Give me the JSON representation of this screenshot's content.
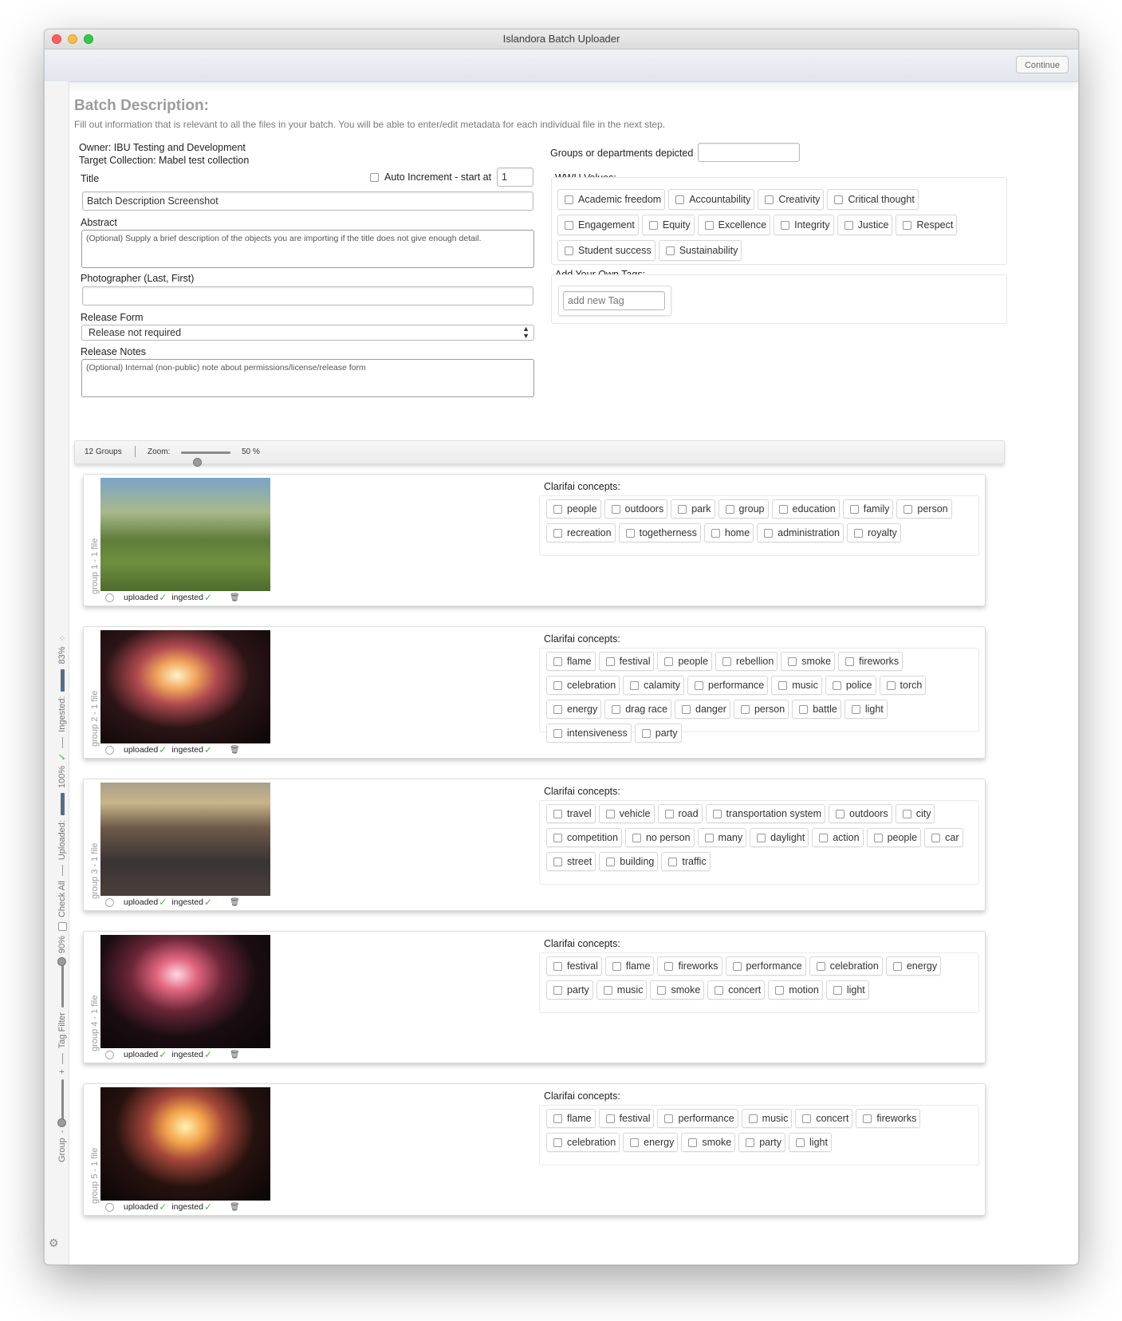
{
  "window": {
    "title": "Islandora Batch Uploader"
  },
  "toolbar": {
    "continue_label": "Continue"
  },
  "sidebar": {
    "ingested_label": "Ingested:",
    "ingested_pct": "83%",
    "ingested_progress": 0.83,
    "uploaded_label": "Uploaded:",
    "uploaded_pct": "100%",
    "uploaded_progress": 1.0,
    "check_all_label": "Check All",
    "tag_filter_label": "Tag Filter",
    "tag_filter_pct": "90%",
    "tag_filter_value": 0.9,
    "group_label": "Group",
    "group_minus": "-",
    "group_plus": "+",
    "group_value": 0.15
  },
  "batch": {
    "heading": "Batch Description:",
    "subtitle": "Fill out information that is relevant to all the files in your batch. You will be able to enter/edit metadata for each individual file in the next step.",
    "owner": "Owner: IBU Testing and Development",
    "target": "Target Collection: Mabel test collection",
    "title_label": "Title",
    "auto_increment_label": "Auto Increment - start at",
    "auto_increment_value": "1",
    "title_value": "Batch Description Screenshot",
    "abstract_label": "Abstract",
    "abstract_placeholder": "(Optional) Supply a brief description of the objects you are importing if the title does not give enough detail.",
    "photographer_label": "Photographer (Last, First)",
    "photographer_value": "",
    "release_form_label": "Release Form",
    "release_form_value": "Release not required",
    "release_notes_label": "Release Notes",
    "release_notes_placeholder": "(Optional) Internal (non-public) note about permissions/license/release form",
    "groups_label": "Groups or departments depicted",
    "groups_value": "",
    "wwu_label": "WWU Values:",
    "wwu_values": [
      "Academic freedom",
      "Accountability",
      "Creativity",
      "Critical thought",
      "Engagement",
      "Equity",
      "Excellence",
      "Integrity",
      "Justice",
      "Respect",
      "Student success",
      "Sustainability"
    ],
    "own_tags_label": "Add Your Own Tags:",
    "own_tags_placeholder": "add new Tag"
  },
  "status": {
    "groups_count": "12 Groups",
    "zoom_label": "Zoom:",
    "zoom_value": "50 %",
    "zoom_level": 0.5
  },
  "groups": [
    {
      "label": "group 1 - 1 file",
      "uploaded": "uploaded",
      "ingested": "ingested",
      "concepts_title": "Clarifai concepts:",
      "concepts": [
        "people",
        "outdoors",
        "park",
        "group",
        "education",
        "family",
        "person",
        "recreation",
        "togetherness",
        "home",
        "administration",
        "royalty"
      ]
    },
    {
      "label": "group 2 - 1 file",
      "uploaded": "uploaded",
      "ingested": "ingested",
      "concepts_title": "Clarifai concepts:",
      "concepts": [
        "flame",
        "festival",
        "people",
        "rebellion",
        "smoke",
        "fireworks",
        "celebration",
        "calamity",
        "performance",
        "music",
        "police",
        "torch",
        "energy",
        "drag race",
        "danger",
        "person",
        "battle",
        "light",
        "intensiveness",
        "party"
      ]
    },
    {
      "label": "group 3 - 1 file",
      "uploaded": "uploaded",
      "ingested": "ingested",
      "concepts_title": "Clarifai concepts:",
      "concepts": [
        "travel",
        "vehicle",
        "road",
        "transportation system",
        "outdoors",
        "city",
        "competition",
        "no person",
        "many",
        "daylight",
        "action",
        "people",
        "car",
        "street",
        "building",
        "traffic"
      ]
    },
    {
      "label": "group 4 - 1 file",
      "uploaded": "uploaded",
      "ingested": "ingested",
      "concepts_title": "Clarifai concepts:",
      "concepts": [
        "festival",
        "flame",
        "fireworks",
        "performance",
        "celebration",
        "energy",
        "party",
        "music",
        "smoke",
        "concert",
        "motion",
        "light"
      ]
    },
    {
      "label": "group 5 - 1 file",
      "uploaded": "uploaded",
      "ingested": "ingested",
      "concepts_title": "Clarifai concepts:",
      "concepts": [
        "flame",
        "festival",
        "performance",
        "music",
        "concert",
        "fireworks",
        "celebration",
        "energy",
        "smoke",
        "party",
        "light"
      ]
    }
  ]
}
